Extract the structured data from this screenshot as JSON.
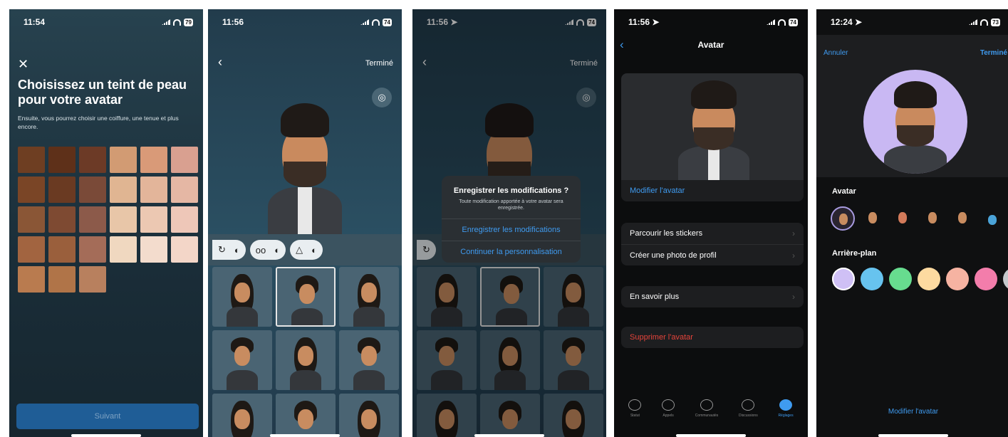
{
  "screens": {
    "s1": {
      "time": "11:54",
      "battery": "79",
      "close_icon": "close-icon",
      "title": "Choisissez un teint de peau pour votre avatar",
      "subtitle": "Ensuite, vous pourrez choisir une coiffure, une tenue et plus encore.",
      "next_label": "Suivant",
      "swatches": [
        "#6e3e22",
        "#5e3019",
        "#6c3a26",
        "#d29b73",
        "#d99a78",
        "#d9a090",
        "#7a4526",
        "#6a3a22",
        "#7a4a38",
        "#e0b592",
        "#e3b59a",
        "#e5b7a4",
        "#8a5636",
        "#7e4a32",
        "#8c5a4a",
        "#e8c6a8",
        "#ecc8b2",
        "#eec7b8",
        "#a26440",
        "#9a5f3c",
        "#a46c58",
        "#f0d8c0",
        "#f3dccd",
        "#f3d6c8",
        "#b97b4f",
        "#b07448",
        "#b8805e"
      ]
    },
    "s2": {
      "time": "11:56",
      "battery": "74",
      "done_label": "Terminé"
    },
    "s3": {
      "time": "11:56 ➤",
      "battery": "74",
      "done_label": "Terminé",
      "dialog_title": "Enregistrer les modifications ?",
      "dialog_body": "Toute modification apportée à votre avatar sera enregistrée.",
      "save_label": "Enregistrer les modifications",
      "continue_label": "Continuer la personnalisation"
    },
    "s4": {
      "time": "11:56 ➤",
      "battery": "74",
      "title": "Avatar",
      "edit_label": "Modifier l'avatar",
      "stickers_label": "Parcourir les stickers",
      "profile_photo_label": "Créer une photo de profil",
      "learn_more_label": "En savoir plus",
      "delete_label": "Supprimer l'avatar",
      "tabs": [
        "Statut",
        "Appels",
        "Communautés",
        "Discussions",
        "Réglages"
      ]
    },
    "s5": {
      "time": "12:24 ➤",
      "battery": "73",
      "cancel_label": "Annuler",
      "done_label": "Terminé",
      "avatar_label": "Avatar",
      "background_label": "Arrière-plan",
      "bg_colors": [
        "#cfc0f5",
        "#67c3ef",
        "#67dc8f",
        "#fddaa0",
        "#f6b3a2",
        "#f37dab",
        "#c5c9cc"
      ],
      "edit_label": "Modifier l'avatar"
    }
  }
}
